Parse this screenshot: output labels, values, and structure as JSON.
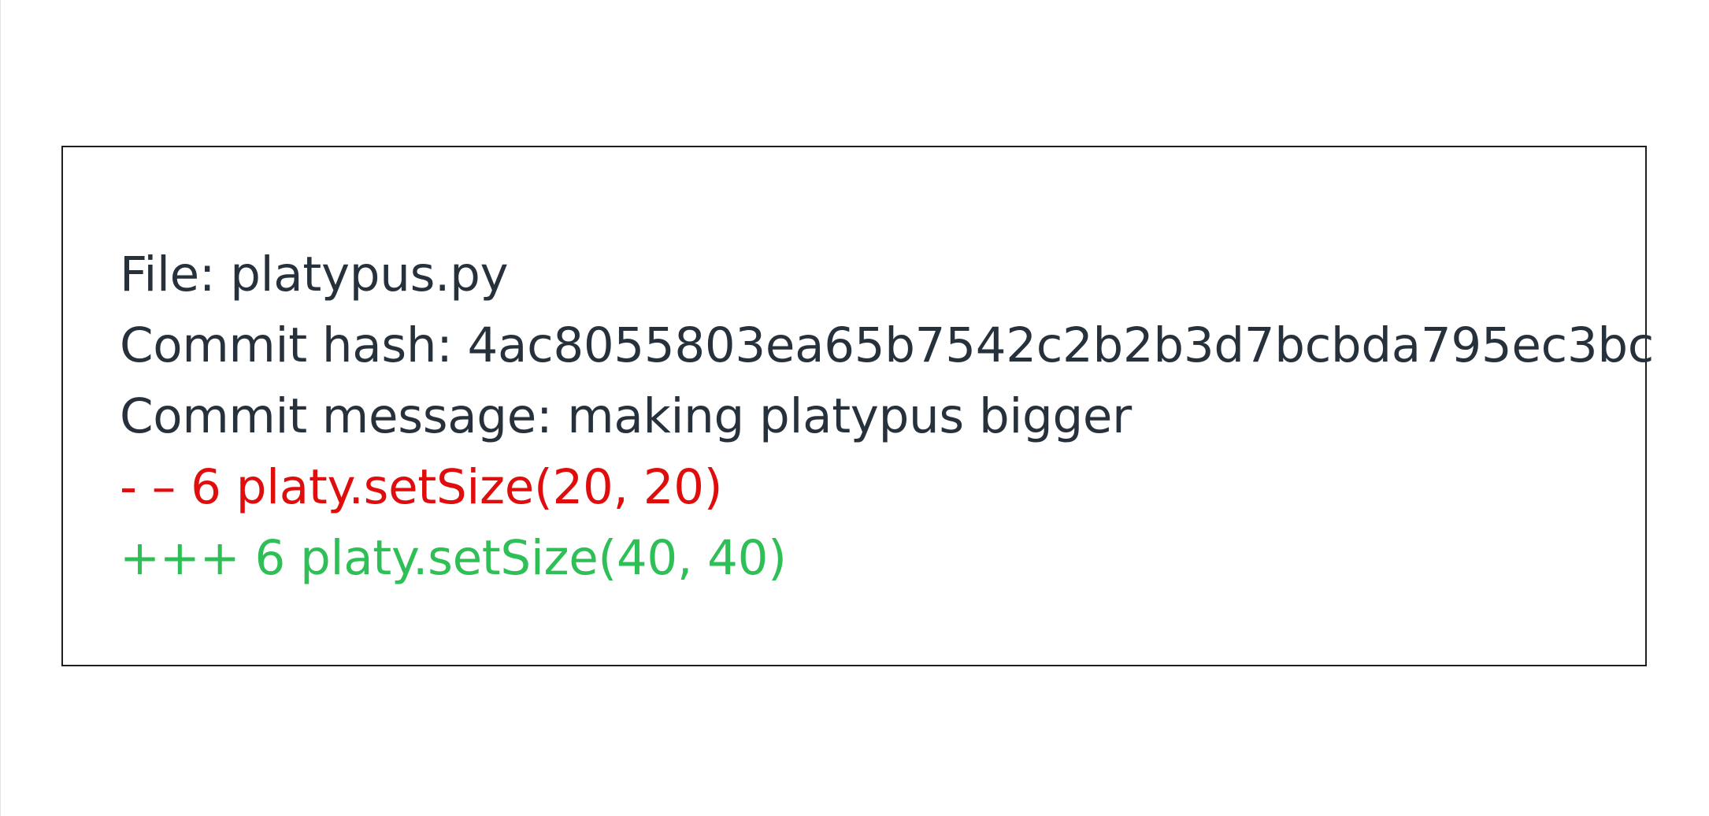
{
  "diff": {
    "file_label": "File: platypus.py",
    "commit_hash_label": "Commit hash: 4ac8055803ea65b7542c2b2b3d7bcbda795ec3bc",
    "commit_message_label": "Commit message: making platypus bigger",
    "removed_line": "- – 6 platy.setSize(20, 20)",
    "added_line": "+++ 6 platy.setSize(40, 40)"
  },
  "colors": {
    "text": "#27313b",
    "removed": "#e00d0d",
    "added": "#2fbf57",
    "border": "#1f1f1f"
  }
}
